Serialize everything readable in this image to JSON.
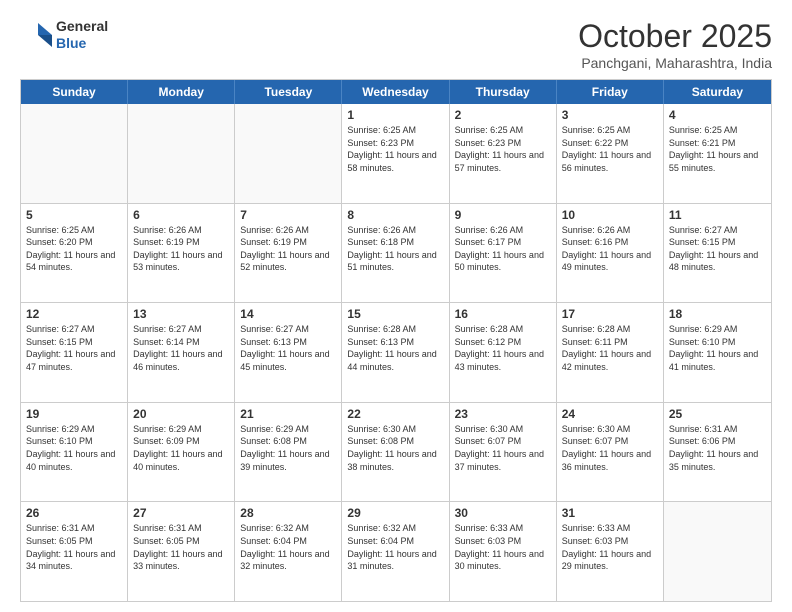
{
  "header": {
    "logo_general": "General",
    "logo_blue": "Blue",
    "month_title": "October 2025",
    "location": "Panchgani, Maharashtra, India"
  },
  "calendar": {
    "days": [
      "Sunday",
      "Monday",
      "Tuesday",
      "Wednesday",
      "Thursday",
      "Friday",
      "Saturday"
    ],
    "rows": [
      [
        {
          "day": "",
          "empty": true
        },
        {
          "day": "",
          "empty": true
        },
        {
          "day": "",
          "empty": true
        },
        {
          "day": "1",
          "sunrise": "6:25 AM",
          "sunset": "6:23 PM",
          "daylight": "11 hours and 58 minutes."
        },
        {
          "day": "2",
          "sunrise": "6:25 AM",
          "sunset": "6:23 PM",
          "daylight": "11 hours and 57 minutes."
        },
        {
          "day": "3",
          "sunrise": "6:25 AM",
          "sunset": "6:22 PM",
          "daylight": "11 hours and 56 minutes."
        },
        {
          "day": "4",
          "sunrise": "6:25 AM",
          "sunset": "6:21 PM",
          "daylight": "11 hours and 55 minutes."
        }
      ],
      [
        {
          "day": "5",
          "sunrise": "6:25 AM",
          "sunset": "6:20 PM",
          "daylight": "11 hours and 54 minutes."
        },
        {
          "day": "6",
          "sunrise": "6:26 AM",
          "sunset": "6:19 PM",
          "daylight": "11 hours and 53 minutes."
        },
        {
          "day": "7",
          "sunrise": "6:26 AM",
          "sunset": "6:19 PM",
          "daylight": "11 hours and 52 minutes."
        },
        {
          "day": "8",
          "sunrise": "6:26 AM",
          "sunset": "6:18 PM",
          "daylight": "11 hours and 51 minutes."
        },
        {
          "day": "9",
          "sunrise": "6:26 AM",
          "sunset": "6:17 PM",
          "daylight": "11 hours and 50 minutes."
        },
        {
          "day": "10",
          "sunrise": "6:26 AM",
          "sunset": "6:16 PM",
          "daylight": "11 hours and 49 minutes."
        },
        {
          "day": "11",
          "sunrise": "6:27 AM",
          "sunset": "6:15 PM",
          "daylight": "11 hours and 48 minutes."
        }
      ],
      [
        {
          "day": "12",
          "sunrise": "6:27 AM",
          "sunset": "6:15 PM",
          "daylight": "11 hours and 47 minutes."
        },
        {
          "day": "13",
          "sunrise": "6:27 AM",
          "sunset": "6:14 PM",
          "daylight": "11 hours and 46 minutes."
        },
        {
          "day": "14",
          "sunrise": "6:27 AM",
          "sunset": "6:13 PM",
          "daylight": "11 hours and 45 minutes."
        },
        {
          "day": "15",
          "sunrise": "6:28 AM",
          "sunset": "6:13 PM",
          "daylight": "11 hours and 44 minutes."
        },
        {
          "day": "16",
          "sunrise": "6:28 AM",
          "sunset": "6:12 PM",
          "daylight": "11 hours and 43 minutes."
        },
        {
          "day": "17",
          "sunrise": "6:28 AM",
          "sunset": "6:11 PM",
          "daylight": "11 hours and 42 minutes."
        },
        {
          "day": "18",
          "sunrise": "6:29 AM",
          "sunset": "6:10 PM",
          "daylight": "11 hours and 41 minutes."
        }
      ],
      [
        {
          "day": "19",
          "sunrise": "6:29 AM",
          "sunset": "6:10 PM",
          "daylight": "11 hours and 40 minutes."
        },
        {
          "day": "20",
          "sunrise": "6:29 AM",
          "sunset": "6:09 PM",
          "daylight": "11 hours and 40 minutes."
        },
        {
          "day": "21",
          "sunrise": "6:29 AM",
          "sunset": "6:08 PM",
          "daylight": "11 hours and 39 minutes."
        },
        {
          "day": "22",
          "sunrise": "6:30 AM",
          "sunset": "6:08 PM",
          "daylight": "11 hours and 38 minutes."
        },
        {
          "day": "23",
          "sunrise": "6:30 AM",
          "sunset": "6:07 PM",
          "daylight": "11 hours and 37 minutes."
        },
        {
          "day": "24",
          "sunrise": "6:30 AM",
          "sunset": "6:07 PM",
          "daylight": "11 hours and 36 minutes."
        },
        {
          "day": "25",
          "sunrise": "6:31 AM",
          "sunset": "6:06 PM",
          "daylight": "11 hours and 35 minutes."
        }
      ],
      [
        {
          "day": "26",
          "sunrise": "6:31 AM",
          "sunset": "6:05 PM",
          "daylight": "11 hours and 34 minutes."
        },
        {
          "day": "27",
          "sunrise": "6:31 AM",
          "sunset": "6:05 PM",
          "daylight": "11 hours and 33 minutes."
        },
        {
          "day": "28",
          "sunrise": "6:32 AM",
          "sunset": "6:04 PM",
          "daylight": "11 hours and 32 minutes."
        },
        {
          "day": "29",
          "sunrise": "6:32 AM",
          "sunset": "6:04 PM",
          "daylight": "11 hours and 31 minutes."
        },
        {
          "day": "30",
          "sunrise": "6:33 AM",
          "sunset": "6:03 PM",
          "daylight": "11 hours and 30 minutes."
        },
        {
          "day": "31",
          "sunrise": "6:33 AM",
          "sunset": "6:03 PM",
          "daylight": "11 hours and 29 minutes."
        },
        {
          "day": "",
          "empty": true
        }
      ]
    ]
  }
}
